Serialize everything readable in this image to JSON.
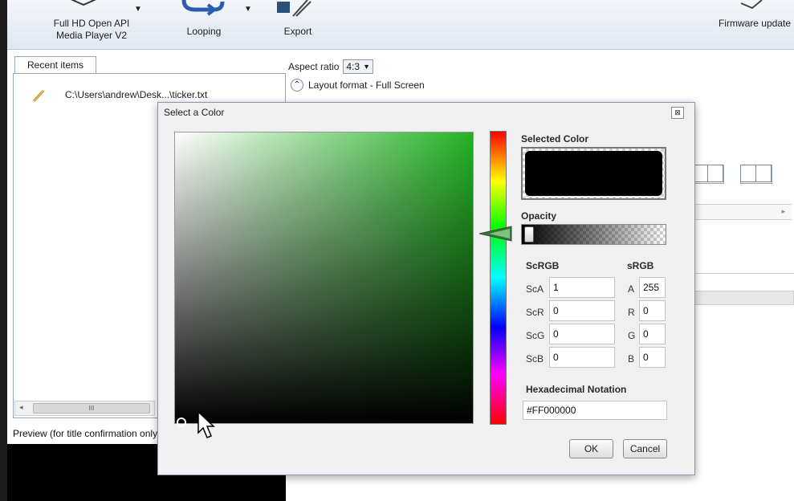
{
  "ribbon": {
    "media_player_label_1": "Full HD Open API",
    "media_player_label_2": "Media Player V2",
    "looping_label": "Looping",
    "export_label": "Export",
    "firmware_label": "Firmware update",
    "dropdown_arrow": "▼"
  },
  "left_pane": {
    "recent_tab": "Recent items",
    "recent_items": [
      "C:\\Users\\andrew\\Desk...\\ticker.txt"
    ],
    "scroll_grip": "III",
    "preview_label": "Preview (for title confirmation only)"
  },
  "main": {
    "aspect_label": "Aspect ratio",
    "aspect_value": "4:3",
    "layout_format_label": "Layout format - Full Screen"
  },
  "dialog": {
    "title": "Select a Color",
    "selected_color_label": "Selected Color",
    "selected_color": "#000000",
    "opacity_label": "Opacity",
    "opacity_value": 0,
    "scrgb_header": "ScRGB",
    "srgb_header": "sRGB",
    "scrgb": [
      {
        "label": "ScA",
        "value": "1"
      },
      {
        "label": "ScR",
        "value": "0"
      },
      {
        "label": "ScG",
        "value": "0"
      },
      {
        "label": "ScB",
        "value": "0"
      }
    ],
    "srgb": [
      {
        "label": "A",
        "value": "255"
      },
      {
        "label": "R",
        "value": "0"
      },
      {
        "label": "G",
        "value": "0"
      },
      {
        "label": "B",
        "value": "0"
      }
    ],
    "hex_label": "Hexadecimal Notation",
    "hex_value": "#FF000000",
    "ok_label": "OK",
    "cancel_label": "Cancel",
    "close_glyph": "⊠",
    "hue_color": "#24b324"
  }
}
